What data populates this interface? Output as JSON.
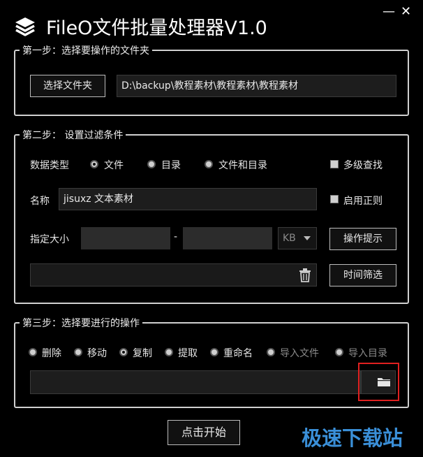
{
  "window": {
    "title": "FileO文件批量处理器V1.0",
    "minimize_glyph": "—",
    "close_glyph": "✕"
  },
  "step1": {
    "legend": "第一步：选择要操作的文件夹",
    "select_button": "选择文件夹",
    "path_value": "D:\\backup\\教程素材\\教程素材\\教程素材"
  },
  "step2": {
    "legend": "第二步： 设置过滤条件",
    "data_type_label": "数据类型",
    "options": [
      "文件",
      "目录",
      "文件和目录"
    ],
    "selected_option": "文件",
    "multi_level_label": "多级查找",
    "name_label": "名称",
    "name_value": "jisuxz 文本素材",
    "regex_label": "启用正则",
    "size_label": "指定大小",
    "size_separator": "-",
    "unit_value": "KB",
    "tips_button": "操作提示",
    "time_filter_button": "时间筛选"
  },
  "step3": {
    "legend": "第三步：选择要进行的操作",
    "operations": [
      "删除",
      "移动",
      "复制",
      "提取",
      "重命名",
      "导入文件",
      "导入目录"
    ],
    "selected_operation": "复制"
  },
  "start_button": "点击开始",
  "watermark": "极速下载站",
  "colors": {
    "background": "#000000",
    "border": "#d0d0d0",
    "highlight_box": "#e02020",
    "watermark": "#3a8fd8"
  }
}
